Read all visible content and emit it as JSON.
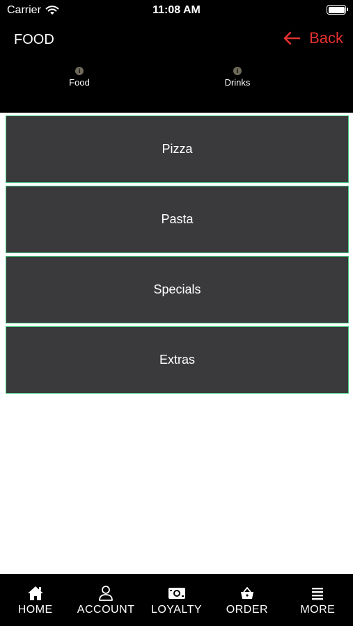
{
  "status_bar": {
    "carrier": "Carrier",
    "time": "11:08 AM"
  },
  "header": {
    "title": "FOOD",
    "back_label": "Back",
    "accent_color": "#e4312f"
  },
  "tabs": [
    {
      "label": "Food",
      "icon": "info-icon"
    },
    {
      "label": "Drinks",
      "icon": "info-icon"
    }
  ],
  "categories": [
    {
      "label": "Pizza"
    },
    {
      "label": "Pasta"
    },
    {
      "label": "Specials"
    },
    {
      "label": "Extras"
    }
  ],
  "category_style": {
    "background": "#3a3a3d",
    "border": "#4bcf87"
  },
  "bottom_nav": [
    {
      "label": "HOME",
      "icon": "home-icon"
    },
    {
      "label": "ACCOUNT",
      "icon": "account-icon"
    },
    {
      "label": "LOYALTY",
      "icon": "loyalty-icon"
    },
    {
      "label": "ORDER",
      "icon": "basket-icon"
    },
    {
      "label": "MORE",
      "icon": "menu-icon"
    }
  ]
}
